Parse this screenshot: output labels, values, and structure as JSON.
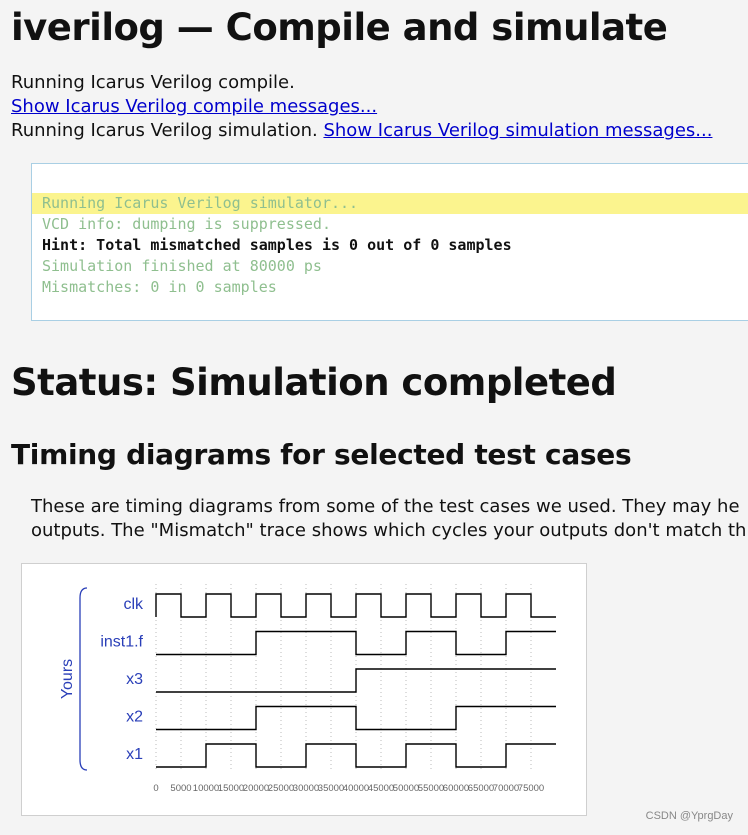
{
  "page": {
    "title": "iverilog — Compile and simulate",
    "compile_line": "Running Icarus Verilog compile.",
    "compile_link": "Show Icarus Verilog compile messages...",
    "sim_line": "Running Icarus Verilog simulation.",
    "sim_link": "Show Icarus Verilog simulation messages..."
  },
  "console": {
    "lines": [
      "Running Icarus Verilog simulator...",
      "VCD info: dumping is suppressed.",
      "Hint: Total mismatched samples is 0 out of 0 samples",
      "Simulation finished at 80000 ps",
      "Mismatches: 0 in 0 samples"
    ]
  },
  "status": {
    "heading": "Status: Simulation completed"
  },
  "timing": {
    "heading": "Timing diagrams for selected test cases",
    "para_line1": "These are timing diagrams from some of the test cases we used. They may he",
    "para_line2": "outputs. The \"Mismatch\" trace shows which cycles your outputs don't match th"
  },
  "diagram": {
    "group_label": "Yours",
    "signals": [
      {
        "name": "clk",
        "transitions": [
          0,
          5000,
          10000,
          15000,
          20000,
          25000,
          30000,
          35000,
          40000,
          45000,
          50000,
          55000,
          60000,
          65000,
          70000,
          75000
        ],
        "initial": 0
      },
      {
        "name": "inst1.f",
        "transitions": [
          20000,
          40000,
          50000,
          60000,
          70000
        ],
        "initial": 0
      },
      {
        "name": "x3",
        "transitions": [
          40000
        ],
        "initial": 0
      },
      {
        "name": "x2",
        "transitions": [
          20000,
          40000,
          60000
        ],
        "initial": 0
      },
      {
        "name": "x1",
        "transitions": [
          10000,
          20000,
          30000,
          40000,
          50000,
          60000,
          70000
        ],
        "initial": 0
      }
    ],
    "time_ticks": [
      "0",
      "5000",
      "10000",
      "15000",
      "20000",
      "25000",
      "30000",
      "35000",
      "40000",
      "45000",
      "50000",
      "55000",
      "60000",
      "65000",
      "70000",
      "75000"
    ],
    "t_max": 80000,
    "colors": {
      "label": "#2a3fb8",
      "trace": "#000000",
      "grid": "#bbbbbb",
      "axis_text": "#666666"
    }
  },
  "watermark": "CSDN @YprgDay"
}
